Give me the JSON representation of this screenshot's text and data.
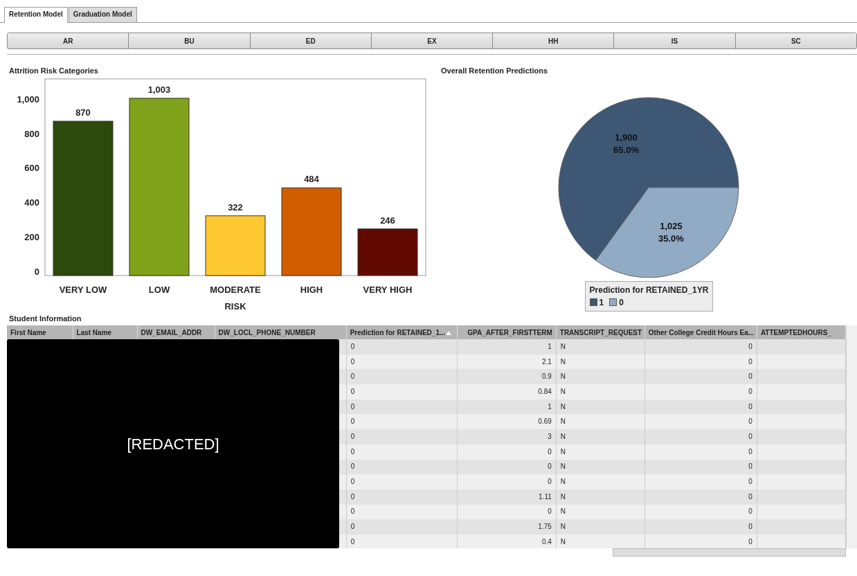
{
  "tabs": [
    {
      "label": "Retention Model",
      "selected": true
    },
    {
      "label": "Graduation Model",
      "selected": false
    }
  ],
  "segments": [
    "AR",
    "BU",
    "ED",
    "EX",
    "HH",
    "IS",
    "SC"
  ],
  "risk_chart": {
    "chart_data": {
      "type": "bar",
      "title": "Attrition Risk Categories",
      "xlabel": "RISK",
      "categories": [
        "VERY LOW",
        "LOW",
        "MODERATE",
        "HIGH",
        "VERY HIGH"
      ],
      "series": [
        {
          "values": [
            870,
            1003,
            322,
            484,
            246
          ]
        }
      ],
      "colors": [
        "#2b4a0b",
        "#7fa21a",
        "#fec832",
        "#d05e00",
        "#620900"
      ],
      "ylim": [
        0,
        1115
      ],
      "yticks": [
        {
          "value": 0,
          "label": "0"
        },
        {
          "value": 200,
          "label": "200"
        },
        {
          "value": 400,
          "label": "400"
        },
        {
          "value": 600,
          "label": "600"
        },
        {
          "value": 800,
          "label": "800"
        },
        {
          "value": 1000,
          "label": "1,000"
        }
      ],
      "value_labels": [
        "870",
        "1,003",
        "322",
        "484",
        "246"
      ]
    }
  },
  "retention_chart": {
    "chart_data": {
      "type": "pie",
      "title": "Overall Retention Predictions",
      "categories": [
        "1",
        "0"
      ],
      "series": [
        {
          "name": "Prediction for RETAINED_1YR",
          "values": [
            65.0,
            35.0
          ]
        }
      ],
      "colors": [
        "#3e5774",
        "#92abc5"
      ],
      "value_labels": [
        "1,900",
        "1,025"
      ],
      "annotations": [
        {
          "text": "65.0%"
        },
        {
          "text": "35.0%"
        }
      ]
    }
  },
  "table": {
    "title": "Student Information",
    "columns": [
      {
        "label": "First Name",
        "kind": "text",
        "sorted": false
      },
      {
        "label": "Last Name",
        "kind": "text",
        "sorted": false
      },
      {
        "label": "DW_EMAIL_ADDR",
        "kind": "text",
        "sorted": false
      },
      {
        "label": "DW_LOCL_PHONE_NUMBER",
        "kind": "text",
        "sorted": false
      },
      {
        "label": "Prediction for RETAINED_1...",
        "kind": "text",
        "sorted": true
      },
      {
        "label": "GPA_AFTER_FIRSTTERM",
        "kind": "number",
        "sorted": false
      },
      {
        "label": "TRANSCRIPT_REQUEST",
        "kind": "text",
        "sorted": false
      },
      {
        "label": "Other College Credit Hours Ea...",
        "kind": "text",
        "sorted": false
      },
      {
        "label": "ATTEMPTEDHOURS_",
        "kind": "text",
        "sorted": false
      }
    ],
    "rows": [
      {
        "prediction": "0",
        "gpa": "1",
        "transcript": "N",
        "other_hours": "0"
      },
      {
        "prediction": "0",
        "gpa": "2.1",
        "transcript": "N",
        "other_hours": "0"
      },
      {
        "prediction": "0",
        "gpa": "0.9",
        "transcript": "N",
        "other_hours": "0"
      },
      {
        "prediction": "0",
        "gpa": "0.84",
        "transcript": "N",
        "other_hours": "0"
      },
      {
        "prediction": "0",
        "gpa": "1",
        "transcript": "N",
        "other_hours": "0"
      },
      {
        "prediction": "0",
        "gpa": "0.69",
        "transcript": "N",
        "other_hours": "0"
      },
      {
        "prediction": "0",
        "gpa": "3",
        "transcript": "N",
        "other_hours": "0"
      },
      {
        "prediction": "0",
        "gpa": "0",
        "transcript": "N",
        "other_hours": "0"
      },
      {
        "prediction": "0",
        "gpa": "0",
        "transcript": "N",
        "other_hours": "0"
      },
      {
        "prediction": "0",
        "gpa": "0",
        "transcript": "N",
        "other_hours": "0"
      },
      {
        "prediction": "0",
        "gpa": "1.11",
        "transcript": "N",
        "other_hours": "0"
      },
      {
        "prediction": "0",
        "gpa": "0",
        "transcript": "N",
        "other_hours": "0"
      },
      {
        "prediction": "0",
        "gpa": "1.75",
        "transcript": "N",
        "other_hours": "0"
      },
      {
        "prediction": "0",
        "gpa": "0.4",
        "transcript": "N",
        "other_hours": "0"
      }
    ],
    "redaction": "[REDACTED]"
  }
}
